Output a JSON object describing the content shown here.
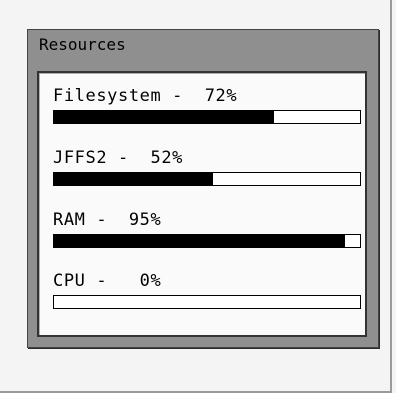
{
  "panel": {
    "title": "Resources",
    "items": [
      {
        "label": "Filesystem -  72%",
        "percent": 72
      },
      {
        "label": "JFFS2 -  52%",
        "percent": 52
      },
      {
        "label": "RAM -  95%",
        "percent": 95
      },
      {
        "label": "CPU -   0%",
        "percent": 0
      }
    ]
  }
}
